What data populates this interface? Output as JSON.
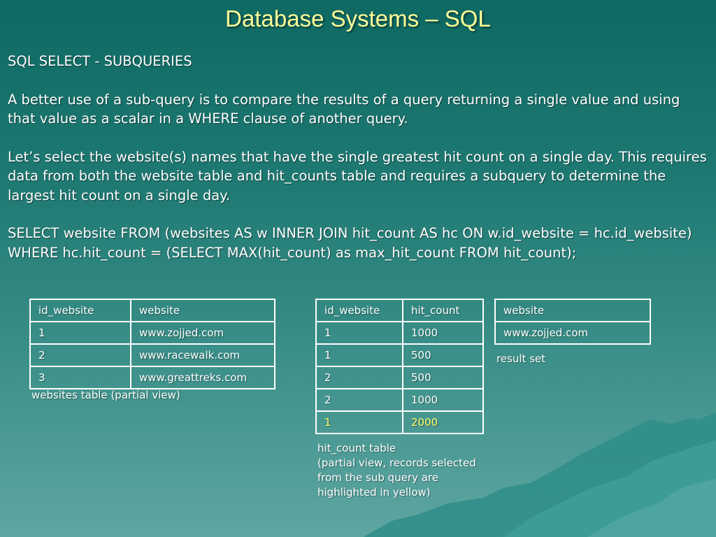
{
  "title": "Database Systems – SQL",
  "subheading": "SQL SELECT - SUBQUERIES",
  "paragraph1": "A better use of a sub-query is to compare the results of a query returning a single value and using that value as a scalar in a WHERE clause of another query.",
  "paragraph2": "Let’s select the website(s) names that have the single greatest hit count on a single day. This requires data from both the website table and hit_counts table and requires a subquery to determine the largest hit count on a single day.",
  "sql": "SELECT website FROM (websites AS w INNER JOIN hit_count AS hc ON w.id_website = hc.id_website) WHERE hc.hit_count = (SELECT MAX(hit_count) as max_hit_count FROM hit_count);",
  "websites_table": {
    "headers": [
      "id_website",
      "website"
    ],
    "rows": [
      [
        "1",
        "www.zojjed.com"
      ],
      [
        "2",
        "www.racewalk.com"
      ],
      [
        "3",
        "www.greattreks.com"
      ]
    ],
    "caption": "websites table (partial view)"
  },
  "hitcount_table": {
    "headers": [
      "id_website",
      "hit_count"
    ],
    "rows": [
      [
        "1",
        "1000"
      ],
      [
        "1",
        "500"
      ],
      [
        "2",
        "500"
      ],
      [
        "2",
        "1000"
      ],
      [
        "1",
        "2000"
      ]
    ],
    "highlight_color": "#ffff66",
    "caption_lines": [
      "hit_count table",
      "(partial view, records selected",
      "from the sub query are",
      "highlighted in yellow)"
    ]
  },
  "result_table": {
    "headers": [
      "website"
    ],
    "rows": [
      [
        "www.zojjed.com"
      ]
    ],
    "caption": "result set"
  },
  "colors": {
    "title": "#ffff99",
    "background_top": "#0f6963",
    "background_bottom": "#5ea6a2",
    "highlight": "#ffff66"
  }
}
